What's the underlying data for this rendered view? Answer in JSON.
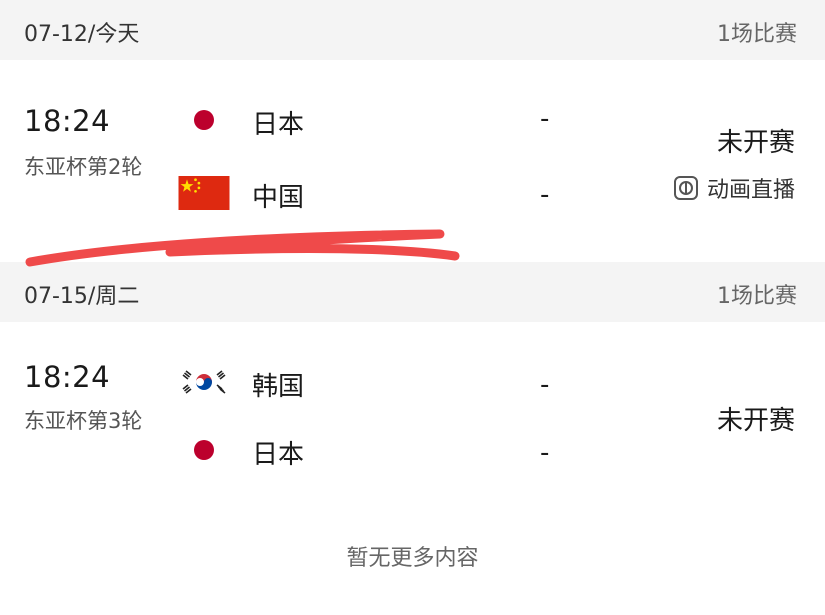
{
  "sections": [
    {
      "date": "07-12/今天",
      "count": "1场比赛",
      "match": {
        "time": "18:24",
        "round": "东亚杯第2轮",
        "home": {
          "name": "日本",
          "flag": "japan-flag-icon"
        },
        "away": {
          "name": "中国",
          "flag": "china-flag-icon"
        },
        "home_score": "-",
        "away_score": "-",
        "status": "未开赛",
        "live_label": "动画直播",
        "live_icon": "animation-live-icon"
      }
    },
    {
      "date": "07-15/周二",
      "count": "1场比赛",
      "match": {
        "time": "18:24",
        "round": "东亚杯第3轮",
        "home": {
          "name": "韩国",
          "flag": "korea-flag-icon"
        },
        "away": {
          "name": "日本",
          "flag": "japan-flag-icon"
        },
        "home_score": "-",
        "away_score": "-",
        "status": "未开赛"
      }
    }
  ],
  "footer": "暂无更多内容",
  "colors": {
    "date_bar_bg": "#f4f4f4",
    "scribble": "#ee3b3b",
    "japan_red": "#bc002d",
    "china_red": "#de2910",
    "china_yellow": "#ffde00"
  }
}
